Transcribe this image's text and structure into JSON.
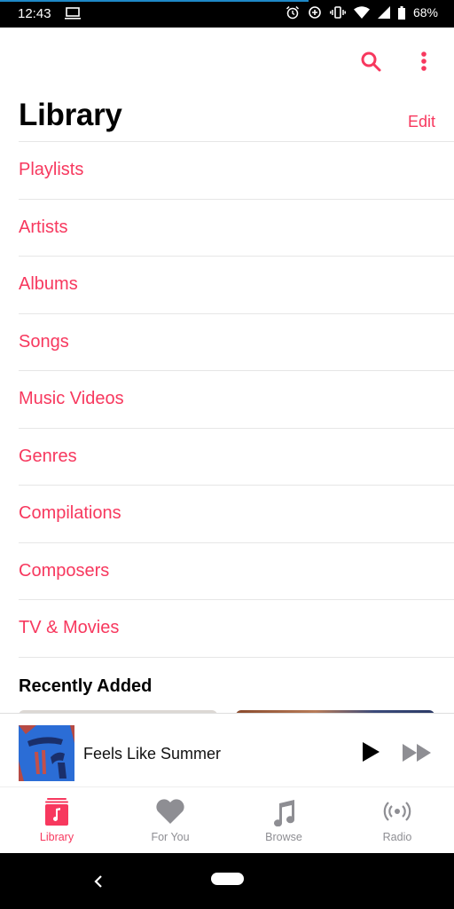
{
  "status_bar": {
    "time": "12:43",
    "battery": "68%",
    "icons": [
      "laptop-icon",
      "alarm-icon",
      "data-saver-icon",
      "vibrate-icon",
      "wifi-icon",
      "signal-icon",
      "battery-icon"
    ],
    "progress_percent": 68
  },
  "header": {
    "title": "Library",
    "edit_label": "Edit",
    "actions": [
      "search-icon",
      "more-vert-icon"
    ]
  },
  "library_items": [
    {
      "label": "Playlists"
    },
    {
      "label": "Artists"
    },
    {
      "label": "Albums"
    },
    {
      "label": "Songs"
    },
    {
      "label": "Music Videos"
    },
    {
      "label": "Genres"
    },
    {
      "label": "Compilations"
    },
    {
      "label": "Composers"
    },
    {
      "label": "TV & Movies"
    }
  ],
  "recently_added": {
    "heading": "Recently Added"
  },
  "now_playing": {
    "title": "Feels Like Summer",
    "controls": [
      "play-icon",
      "fast-forward-icon"
    ]
  },
  "tabs": [
    {
      "label": "Library",
      "icon": "library-icon",
      "active": true
    },
    {
      "label": "For You",
      "icon": "heart-icon",
      "active": false
    },
    {
      "label": "Browse",
      "icon": "music-note-icon",
      "active": false
    },
    {
      "label": "Radio",
      "icon": "radio-icon",
      "active": false
    }
  ],
  "colors": {
    "accent": "#f7385e",
    "inactive": "#8e8e93",
    "status_progress": "#1e88c7"
  }
}
